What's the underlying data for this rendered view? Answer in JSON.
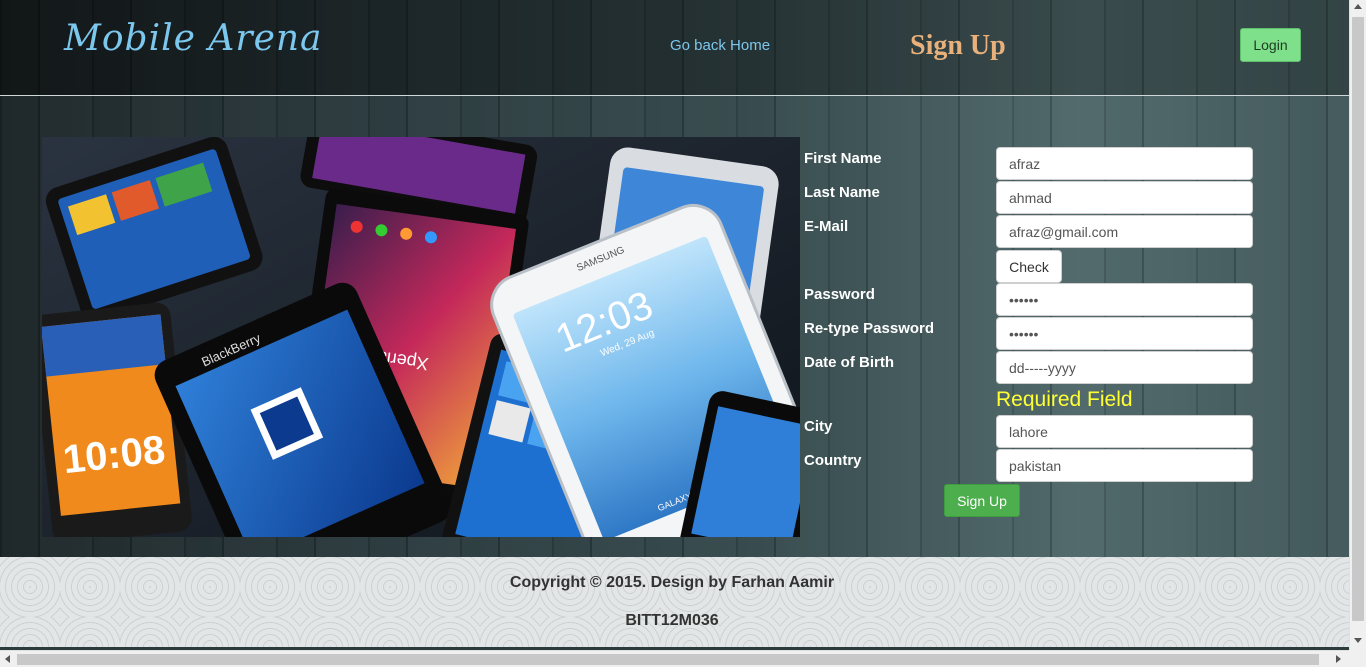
{
  "header": {
    "logo": "Mobile Arena",
    "home_link": "Go back Home",
    "page_title": "Sign Up",
    "login_label": "Login"
  },
  "hero": {
    "icon": "phones-collage-image",
    "phone_texts": {
      "clock_1": "12:03",
      "date_1": "Wed, 29 Aug",
      "brand_1": "Xperia Z",
      "brand_2": "BlackBerry",
      "brand_3": "SAMSUNG",
      "clock_2": "10:08",
      "model_1": "GALAXY Note II"
    }
  },
  "form": {
    "first_name": {
      "label": "First Name",
      "value": "afraz"
    },
    "last_name": {
      "label": "Last Name",
      "value": "ahmad"
    },
    "email": {
      "label": "E-Mail",
      "value": "afraz@gmail.com"
    },
    "check_label": "Check",
    "password": {
      "label": "Password",
      "value": "••••••"
    },
    "retype_password": {
      "label": "Re-type Password",
      "value": "••••••"
    },
    "dob": {
      "label": "Date of Birth",
      "placeholder": "dd-----yyyy"
    },
    "required_msg": "Required Field",
    "city": {
      "label": "City",
      "value": "lahore"
    },
    "country": {
      "label": "Country",
      "value": "pakistan"
    },
    "submit_label": "Sign Up"
  },
  "footer": {
    "copyright": "Copyright © 2015. Design by Farhan Aamir",
    "roll_no": "BITT12M036"
  },
  "colors": {
    "logo": "#7cc7ee",
    "title": "#e8b07a",
    "login_bg": "#7ee08a",
    "signup_bg": "#4cae4c",
    "required": "#ffff33"
  }
}
